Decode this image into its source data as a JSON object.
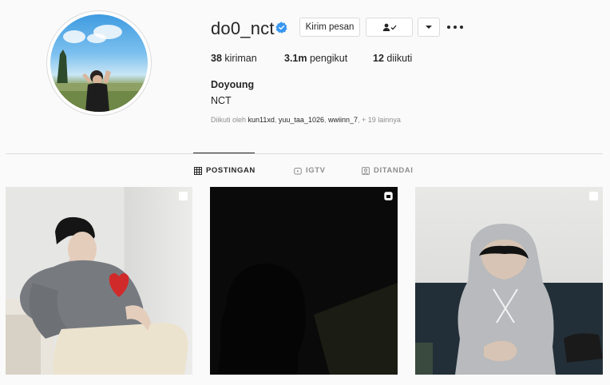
{
  "profile": {
    "username": "do0_nct",
    "verified": true,
    "full_name": "Doyoung",
    "bio": "NCT"
  },
  "actions": {
    "message_label": "Kirim pesan",
    "follow_icon": "person-check-icon",
    "dropdown_icon": "caret-down-icon",
    "more_icon": "ellipsis-icon"
  },
  "stats": {
    "posts_count": "38",
    "posts_label": " kiriman",
    "followers_count": "3.1m",
    "followers_label": " pengikut",
    "following_count": "12",
    "following_label": " diikuti"
  },
  "followed_by": {
    "prefix": "Diikuti oleh ",
    "names": [
      "kun11xd",
      "yuu_taa_1026",
      "wwiinn_7"
    ],
    "suffix": "+ 19 lainnya"
  },
  "tabs": [
    {
      "label": "POSTINGAN",
      "icon": "grid-icon",
      "active": true
    },
    {
      "label": "IGTV",
      "icon": "igtv-icon",
      "active": false
    },
    {
      "label": "DITANDAI",
      "icon": "tagged-icon",
      "active": false
    }
  ],
  "posts": [
    {
      "badge": "multiple-posts-icon"
    },
    {
      "badge": "video-icon"
    },
    {
      "badge": "multiple-posts-icon"
    }
  ],
  "colors": {
    "verified_blue": "#3897f0",
    "text": "#262626",
    "muted": "#8e8e8e",
    "border": "#dbdbdb"
  }
}
